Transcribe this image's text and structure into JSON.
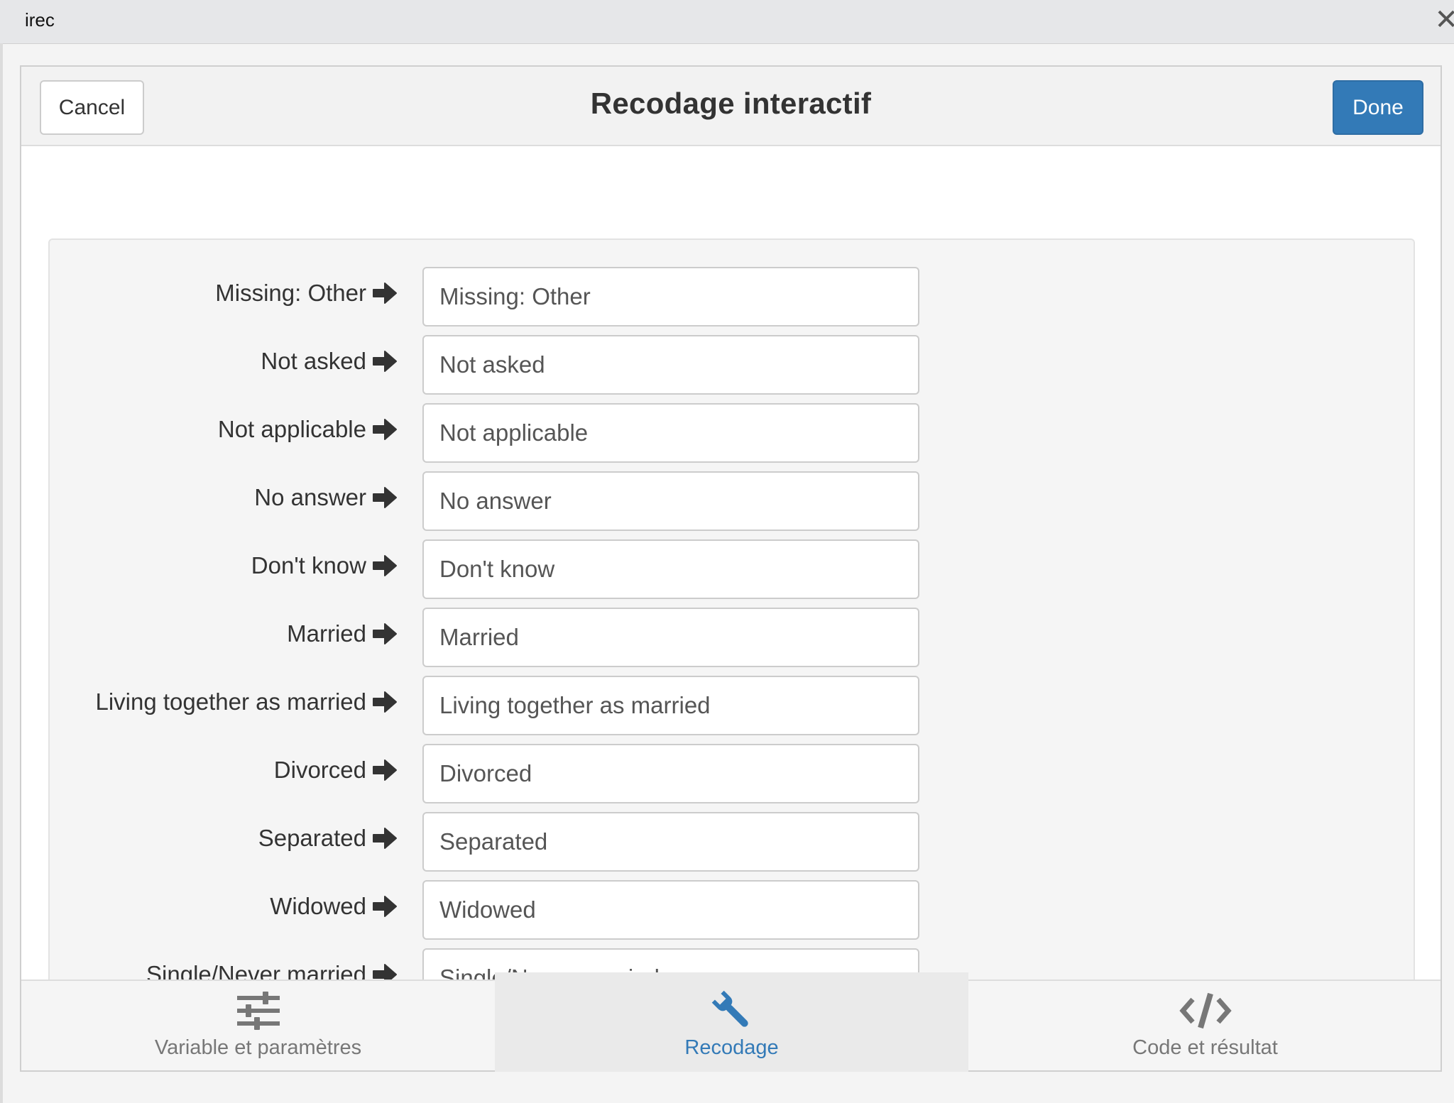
{
  "window": {
    "title": "irec",
    "close_glyph": "✕"
  },
  "gadget": {
    "cancel_label": "Cancel",
    "title": "Recodage interactif",
    "done_label": "Done"
  },
  "rows": [
    {
      "label": "Missing: Other",
      "value": "Missing: Other"
    },
    {
      "label": "Not asked",
      "value": "Not asked"
    },
    {
      "label": "Not applicable",
      "value": "Not applicable"
    },
    {
      "label": "No answer",
      "value": "No answer"
    },
    {
      "label": "Don't know",
      "value": "Don't know"
    },
    {
      "label": "Married",
      "value": "Married"
    },
    {
      "label": "Living together as married",
      "value": "Living together as married"
    },
    {
      "label": "Divorced",
      "value": "Divorced"
    },
    {
      "label": "Separated",
      "value": "Separated"
    },
    {
      "label": "Widowed",
      "value": "Widowed"
    },
    {
      "label": "Single/Never married",
      "value": "Single/Never married"
    }
  ],
  "tabs": [
    {
      "label": "Variable et paramètres",
      "icon": "sliders-icon",
      "active": false
    },
    {
      "label": "Recodage",
      "icon": "wrench-icon",
      "active": true
    },
    {
      "label": "Code et résultat",
      "icon": "code-icon",
      "active": false
    }
  ],
  "colors": {
    "primary": "#337ab7",
    "muted": "#777777",
    "text": "#333333"
  }
}
